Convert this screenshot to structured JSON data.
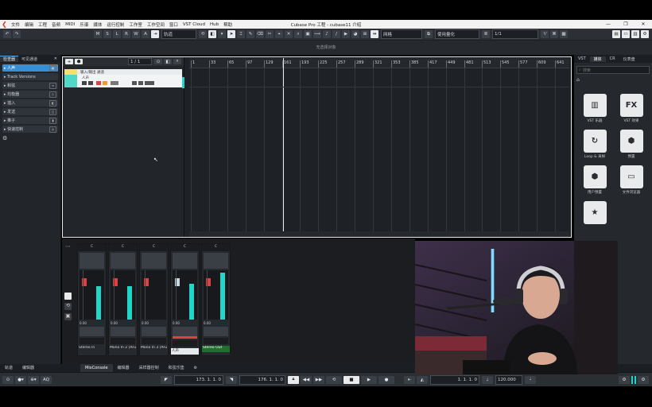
{
  "titlebar": {
    "menus": [
      "文件",
      "编辑",
      "工程",
      "音频",
      "MIDI",
      "乐谱",
      "媒体",
      "运行控制",
      "工作室",
      "工作空间",
      "窗口",
      "VST Cloud",
      "Hub",
      "帮助"
    ],
    "title": "Cubase Pro 工程 - cubase11 介绍",
    "controls": [
      "—",
      "❐",
      "✕"
    ]
  },
  "toolbar": {
    "msrwa": [
      "M",
      "S",
      "L",
      "R",
      "W",
      "A"
    ],
    "track_field": "轨道",
    "grid_type": "网格",
    "quantize": "使用量化",
    "quantize_value": "1/1"
  },
  "info_line": "无选择对象",
  "left_zone": {
    "tabs": [
      "检查器",
      "可见通道"
    ],
    "items": [
      {
        "label": "人声",
        "icon": "●"
      },
      {
        "label": "Track Versions",
        "icon": ""
      },
      {
        "label": "和弦",
        "icon": "≡"
      },
      {
        "label": "均衡器",
        "icon": "◇"
      },
      {
        "label": "插入",
        "icon": "◧"
      },
      {
        "label": "发送",
        "icon": "◫"
      },
      {
        "label": "推子",
        "icon": "▮"
      },
      {
        "label": "快速控制",
        "icon": "◎"
      }
    ]
  },
  "project": {
    "counter": "1 / 1",
    "folder_track": "输入/输出 通道",
    "audio_track": "人声",
    "ruler": [
      "1",
      "33",
      "65",
      "97",
      "129",
      "161",
      "193",
      "225",
      "257",
      "289",
      "321",
      "353",
      "385",
      "417",
      "449",
      "481",
      "513",
      "545",
      "577",
      "609",
      "641"
    ]
  },
  "mixer": {
    "title": "MixConsole",
    "channels": [
      {
        "name": "Stereo In",
        "value": "0.00",
        "pan": "C",
        "level": 0.7
      },
      {
        "name": "Mono In 2 (Aru",
        "value": "0.00",
        "pan": "C",
        "level": 0.7
      },
      {
        "name": "Mono In 3 (Aru",
        "value": "0.00",
        "pan": "C",
        "level": 0.0
      },
      {
        "name": "人声",
        "value": "0.00",
        "pan": "C",
        "level": 0.75
      },
      {
        "name": "Stereo Out",
        "value": "0.00",
        "pan": "C",
        "level": 0.98
      }
    ]
  },
  "right_zone": {
    "tabs": [
      "VST",
      "媒体",
      "CR",
      "仪表盘"
    ],
    "search_placeholder": "搜索",
    "tiles": [
      {
        "glyph": "▥",
        "label": "VST 乐器"
      },
      {
        "glyph": "FX",
        "label": "VST 效果"
      },
      {
        "glyph": "↻",
        "label": "Loop & 采样"
      },
      {
        "glyph": "⬢",
        "label": "预置"
      },
      {
        "glyph": "⬢",
        "label": "用户预置"
      },
      {
        "glyph": "▭",
        "label": "文件浏览器"
      },
      {
        "glyph": "★",
        "label": ""
      }
    ]
  },
  "bottom_tabs": {
    "left": [
      "轨道",
      "编辑器"
    ],
    "right": [
      "MixConsole",
      "编辑器",
      "采样器控制",
      "和弦乐垫"
    ]
  },
  "transport": {
    "left_locator": "173. 1. 1.  0",
    "right_locator": "176. 1. 1.  0",
    "position": "1. 1. 1.  0",
    "tempo": "120.000"
  },
  "colors": {
    "accent": "#3a8fd1",
    "meter": "#20d6c8",
    "fader_red": "#e04040"
  }
}
